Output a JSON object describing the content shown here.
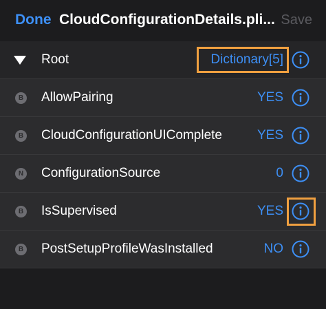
{
  "navbar": {
    "done_label": "Done",
    "title": "CloudConfigurationDetails.pli...",
    "save_label": "Save"
  },
  "root": {
    "label": "Root",
    "value": "Dictionary[5]"
  },
  "items": [
    {
      "type_badge": "B",
      "key": "AllowPairing",
      "value": "YES"
    },
    {
      "type_badge": "B",
      "key": "CloudConfigurationUIComplete",
      "value": "YES"
    },
    {
      "type_badge": "N",
      "key": "ConfigurationSource",
      "value": "0"
    },
    {
      "type_badge": "B",
      "key": "IsSupervised",
      "value": "YES"
    },
    {
      "type_badge": "B",
      "key": "PostSetupProfileWasInstalled",
      "value": "NO"
    }
  ],
  "icons": {
    "info": "info-circle-icon",
    "disclosure": "disclosure-triangle-icon"
  },
  "colors": {
    "accent": "#3d8ff5",
    "highlight": "#f0a040",
    "background": "#1c1c1e",
    "row_background": "#2c2c2e"
  }
}
